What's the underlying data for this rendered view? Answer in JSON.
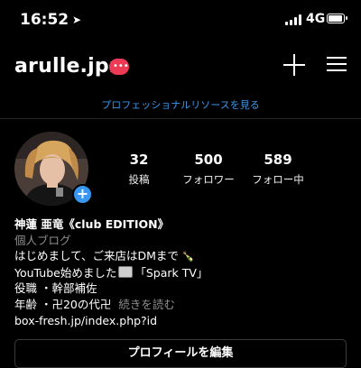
{
  "status_bar": {
    "time": "16:52",
    "location_icon": "location-arrow-icon",
    "network": "4G",
    "signal_icon": "cell-signal-icon",
    "battery_icon": "battery-icon"
  },
  "header": {
    "username": "arulle.jpn",
    "badge_text": "•••",
    "badge_color": "#ef3a55",
    "new_post_icon": "plus-icon",
    "menu_icon": "hamburger-menu-icon"
  },
  "professional_link": "プロフェッショナルリソースを見る",
  "profile": {
    "add_story_label": "+",
    "stats": [
      {
        "value": "32",
        "label": "投稿"
      },
      {
        "value": "500",
        "label": "フォロワー"
      },
      {
        "value": "589",
        "label": "フォロー中"
      }
    ]
  },
  "bio": {
    "name": "神蓮 亜竜《club EDITION》",
    "category": "個人ブログ",
    "line1": "はじめまして、ご来店はDMまで",
    "line2_pre": "YouTube始めました",
    "line2_post": "「Spark TV」",
    "line3": "役職 ・幹部補佐",
    "line4": "年齢 ・卍20の代卍",
    "more": "続きを読む",
    "link": "box-fresh.jp/index.php?id"
  },
  "edit_profile_label": "プロフィールを編集",
  "colors": {
    "accent_link": "#3d95e7",
    "add_button": "#3897f0",
    "background": "#000000"
  }
}
